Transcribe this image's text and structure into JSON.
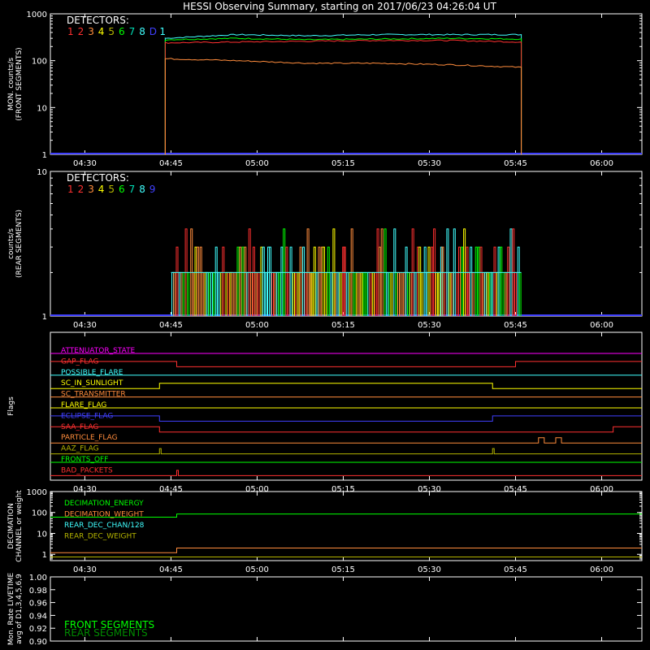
{
  "title": "HESSI Observing Summary, starting on 2017/06/23 04:26:04 UT",
  "time_axis": {
    "start": "04:24",
    "end": "06:07",
    "ticks": [
      "04:30",
      "04:45",
      "05:00",
      "05:15",
      "05:30",
      "05:45",
      "06:00"
    ]
  },
  "colors": {
    "axis": "#ffffff",
    "d1": "#ff3030",
    "d2": "#ff3030",
    "d3": "#ff8c3c",
    "d4": "#ffff00",
    "d5": "#b4b400",
    "d6": "#00ff00",
    "d7": "#00dcb4",
    "d8": "#40ffff",
    "d9": "#4040ff"
  },
  "chart_data": [
    {
      "id": "front",
      "type": "line",
      "ylabel": [
        "MON. counts/s",
        "(FRONT SEGMENTS)"
      ],
      "yscale": "log",
      "ylim": [
        1,
        1000
      ],
      "yticks": [
        "1",
        "10",
        "100",
        "1000"
      ],
      "legend_title": "DETECTORS:",
      "legend_items": [
        {
          "label": "1",
          "color": "#ff3030"
        },
        {
          "label": "2",
          "color": "#ff3030"
        },
        {
          "label": "3",
          "color": "#ff8c3c"
        },
        {
          "label": "4",
          "color": "#ffff00"
        },
        {
          "label": "5",
          "color": "#b4b400"
        },
        {
          "label": "6",
          "color": "#00ff00"
        },
        {
          "label": "7",
          "color": "#00dcb4"
        },
        {
          "label": "8",
          "color": "#40ffff"
        },
        {
          "label": "D",
          "color": "#4040ff"
        },
        {
          "label": "1",
          "color": "#40ffff"
        }
      ],
      "active": [
        "04:44",
        "05:46"
      ],
      "series": [
        {
          "name": "1",
          "color": "#40ffff",
          "values": [
            {
              "t": "04:44",
              "v": 300
            },
            {
              "t": "04:45",
              "v": 360
            },
            {
              "t": "05:00",
              "v": 340
            },
            {
              "t": "05:15",
              "v": 360
            },
            {
              "t": "05:30",
              "v": 360
            },
            {
              "t": "05:46",
              "v": 360
            }
          ]
        },
        {
          "name": "6",
          "color": "#00ff00",
          "values": [
            {
              "t": "04:44",
              "v": 280
            },
            {
              "t": "04:45",
              "v": 300
            },
            {
              "t": "05:00",
              "v": 280
            },
            {
              "t": "05:15",
              "v": 290
            },
            {
              "t": "05:30",
              "v": 300
            },
            {
              "t": "05:46",
              "v": 290
            }
          ]
        },
        {
          "name": "2",
          "color": "#ff3030",
          "values": [
            {
              "t": "04:44",
              "v": 240
            },
            {
              "t": "04:45",
              "v": 250
            },
            {
              "t": "05:00",
              "v": 260
            },
            {
              "t": "05:15",
              "v": 270
            },
            {
              "t": "05:30",
              "v": 270
            },
            {
              "t": "05:46",
              "v": 250
            }
          ]
        },
        {
          "name": "3",
          "color": "#ff8c3c",
          "values": [
            {
              "t": "04:44",
              "v": 110
            },
            {
              "t": "04:45",
              "v": 100
            },
            {
              "t": "05:00",
              "v": 88
            },
            {
              "t": "05:15",
              "v": 88
            },
            {
              "t": "05:30",
              "v": 82
            },
            {
              "t": "05:46",
              "v": 72
            }
          ]
        }
      ]
    },
    {
      "id": "rear",
      "type": "line",
      "ylabel": [
        "counts/s",
        "(REAR SEGMENTS)"
      ],
      "yscale": "log",
      "ylim": [
        1,
        10
      ],
      "yticks": [
        "1",
        "10"
      ],
      "legend_title": "DETECTORS:",
      "legend_items": [
        {
          "label": "1",
          "color": "#ff3030"
        },
        {
          "label": "2",
          "color": "#ff3030"
        },
        {
          "label": "3",
          "color": "#ff8c3c"
        },
        {
          "label": "4",
          "color": "#ffff00"
        },
        {
          "label": "5",
          "color": "#b4b400"
        },
        {
          "label": "6",
          "color": "#00ff00"
        },
        {
          "label": "7",
          "color": "#00dcb4"
        },
        {
          "label": "8",
          "color": "#40ffff"
        },
        {
          "label": "9",
          "color": "#4040ff"
        }
      ],
      "active": [
        "04:45",
        "05:46"
      ],
      "levels": [
        2,
        3,
        4
      ],
      "level_colors": [
        "#40ffff",
        "#00ff00",
        "#ffff00",
        "#ff8c3c",
        "#ff3030"
      ]
    },
    {
      "id": "flags",
      "type": "line",
      "ylabel": [
        "Flags"
      ],
      "series": [
        {
          "name": "ATTENUATOR_STATE",
          "color": "#ff00ff",
          "steps": []
        },
        {
          "name": "GAP_FLAG",
          "color": "#ff3030",
          "steps": [
            "04:46",
            "05:45"
          ]
        },
        {
          "name": "POSSIBLE_FLARE",
          "color": "#40ffff",
          "steps": []
        },
        {
          "name": "SC_IN_SUNLIGHT",
          "color": "#ffff00",
          "steps": [
            "04:43",
            "05:41"
          ]
        },
        {
          "name": "SC_TRANSMITTER",
          "color": "#ff8c3c",
          "steps": []
        },
        {
          "name": "FLARE_FLAG",
          "color": "#ffff00",
          "steps": []
        },
        {
          "name": "ECLIPSE_FLAG",
          "color": "#4040ff",
          "steps": [
            "04:43",
            "05:41"
          ]
        },
        {
          "name": "SAA_FLAG",
          "color": "#ff3030",
          "steps": [
            "04:43",
            "06:02"
          ]
        },
        {
          "name": "PARTICLE_FLAG",
          "color": "#ff8c3c",
          "steps": [
            "05:49",
            "05:50",
            "05:52",
            "05:53"
          ]
        },
        {
          "name": "AAZ_FLAG",
          "color": "#b4b400",
          "steps": [
            "04:43",
            "04:43",
            "05:41",
            "05:41"
          ]
        },
        {
          "name": "FRONTS_OFF",
          "color": "#00ff00",
          "steps": []
        },
        {
          "name": "BAD_PACKETS",
          "color": "#ff3030",
          "steps": [
            "04:46",
            "04:46"
          ]
        }
      ]
    },
    {
      "id": "decimation",
      "type": "line",
      "ylabel": [
        "DECIMATION",
        "CHANNEL or weight"
      ],
      "yscale": "log",
      "ylim": [
        0.5,
        1000
      ],
      "yticks": [
        "1",
        "10",
        "100",
        "1000"
      ],
      "series": [
        {
          "name": "DECIMATION_ENERGY",
          "color": "#00ff00",
          "values": [
            {
              "t": "04:24",
              "v": 60
            },
            {
              "t": "04:46",
              "v": 60
            },
            {
              "t": "04:46",
              "v": 85
            },
            {
              "t": "06:07",
              "v": 85
            }
          ]
        },
        {
          "name": "DECIMATION_WEIGHT",
          "color": "#ff8c3c",
          "values": [
            {
              "t": "04:24",
              "v": 1.2
            },
            {
              "t": "04:46",
              "v": 1.2
            },
            {
              "t": "04:46",
              "v": 2
            },
            {
              "t": "06:07",
              "v": 2
            }
          ]
        },
        {
          "name": "REAR_DEC_CHAN/128",
          "color": "#40ffff",
          "values": []
        },
        {
          "name": "REAR_DEC_WEIGHT",
          "color": "#b4b400",
          "values": [
            {
              "t": "04:24",
              "v": 0.75
            },
            {
              "t": "06:07",
              "v": 0.75
            }
          ]
        }
      ]
    },
    {
      "id": "livetime",
      "type": "line",
      "ylabel": [
        "Mon. Rate LIVETIME",
        "avg of D1,3,4,5,6,9"
      ],
      "ylim": [
        0.9,
        1.0
      ],
      "yticks": [
        "0.90",
        "0.92",
        "0.94",
        "0.96",
        "0.98",
        "1.00"
      ],
      "series": [
        {
          "name": "FRONT SEGMENTS",
          "color": "#00ff00",
          "values": []
        },
        {
          "name": "REAR SEGMENTS",
          "color": "#008c00",
          "values": []
        }
      ]
    }
  ]
}
